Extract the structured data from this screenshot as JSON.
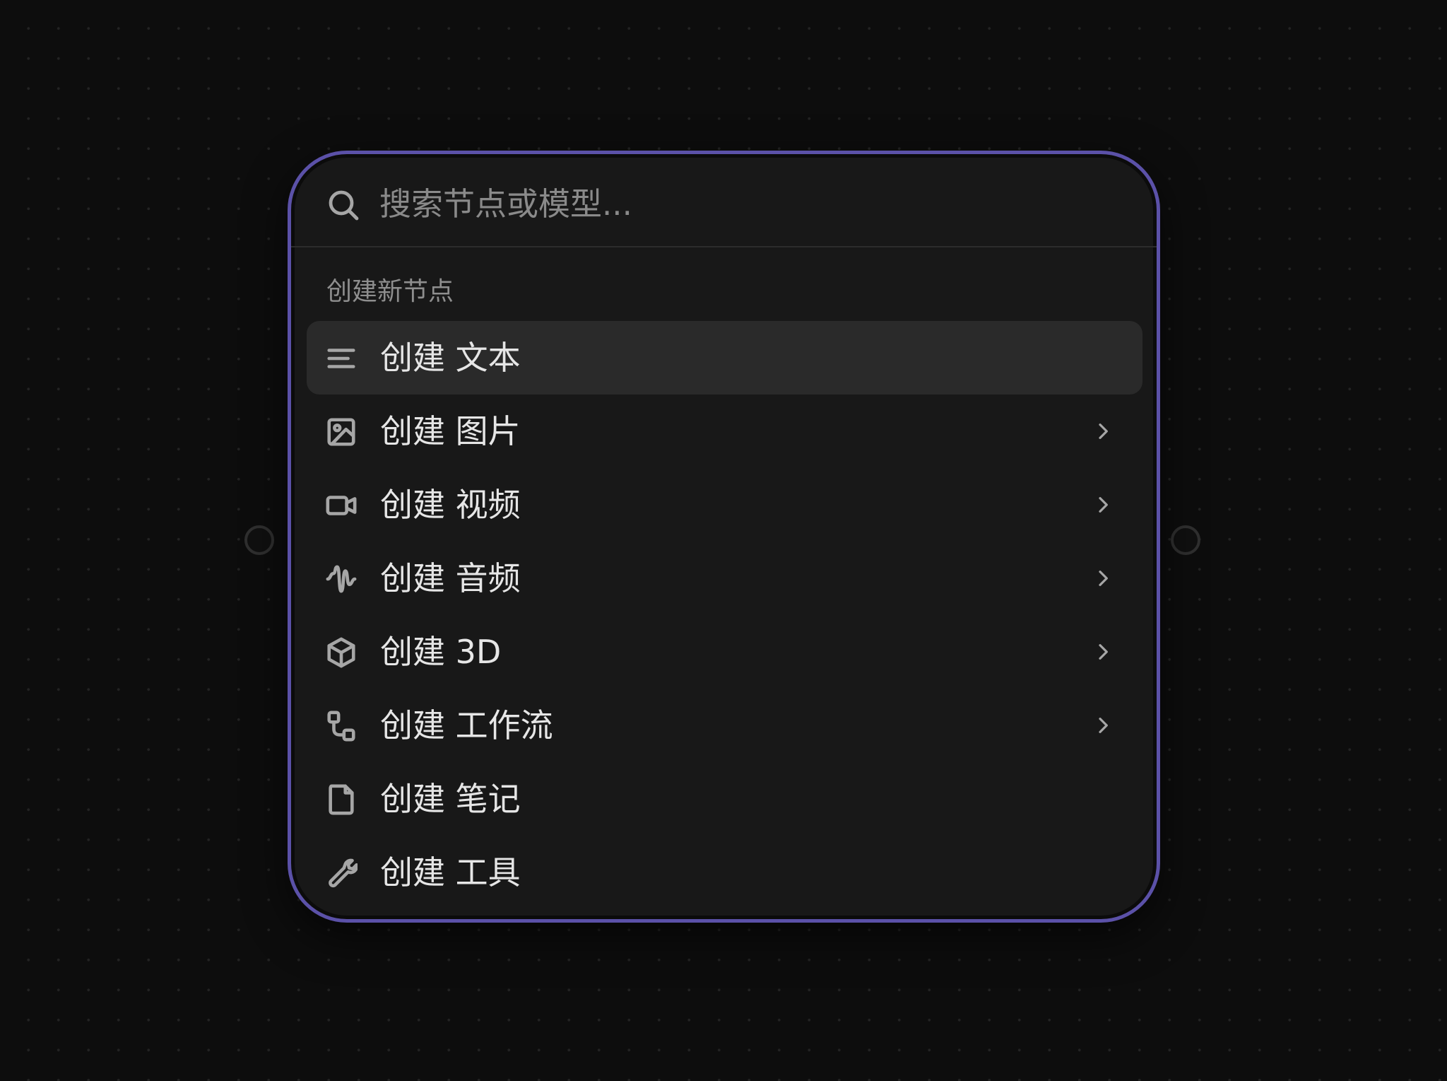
{
  "search": {
    "placeholder": "搜索节点或模型..."
  },
  "section": {
    "label": "创建新节点"
  },
  "menu": {
    "items": [
      {
        "label": "创建 文本",
        "icon": "text-lines-icon",
        "submenu": false,
        "active": true
      },
      {
        "label": "创建 图片",
        "icon": "image-icon",
        "submenu": true,
        "active": false
      },
      {
        "label": "创建 视频",
        "icon": "video-camera-icon",
        "submenu": true,
        "active": false
      },
      {
        "label": "创建 音频",
        "icon": "audio-wave-icon",
        "submenu": true,
        "active": false
      },
      {
        "label": "创建 3D",
        "icon": "cube-icon",
        "submenu": true,
        "active": false
      },
      {
        "label": "创建 工作流",
        "icon": "workflow-icon",
        "submenu": true,
        "active": false
      },
      {
        "label": "创建 笔记",
        "icon": "note-icon",
        "submenu": false,
        "active": false
      },
      {
        "label": "创建 工具",
        "icon": "wrench-icon",
        "submenu": false,
        "active": false
      }
    ]
  },
  "colors": {
    "background": "#0d0d0d",
    "panel": "#181818",
    "panel_border": "#5b51a8",
    "active_row": "#2a2a2a",
    "text": "#e6e6e6",
    "muted_text": "#8e8e8e"
  }
}
